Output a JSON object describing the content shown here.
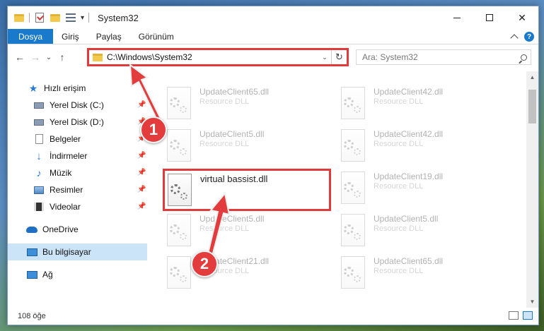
{
  "window": {
    "title": "System32",
    "controls": {
      "minimize": "",
      "maximize": "",
      "close": "✕"
    }
  },
  "ribbon": {
    "tabs": [
      "Dosya",
      "Giriş",
      "Paylaş",
      "Görünüm"
    ],
    "help": "?"
  },
  "nav": {
    "back": "←",
    "forward": "→",
    "recent": "⌄",
    "up": "↑",
    "address": "C:\\Windows\\System32",
    "address_chevron": "⌄",
    "refresh": "↻",
    "search_placeholder": "Ara: System32"
  },
  "sidebar": {
    "quick_access": "Hızlı erişim",
    "items": [
      {
        "label": "Yerel Disk (C:)",
        "icon": "drive-icon"
      },
      {
        "label": "Yerel Disk (D:)",
        "icon": "drive-icon"
      },
      {
        "label": "Belgeler",
        "icon": "documents-icon"
      },
      {
        "label": "İndirmeler",
        "icon": "downloads-icon"
      },
      {
        "label": "Müzik",
        "icon": "music-icon"
      },
      {
        "label": "Resimler",
        "icon": "pictures-icon"
      },
      {
        "label": "Videolar",
        "icon": "videos-icon"
      }
    ],
    "onedrive": "OneDrive",
    "this_pc": "Bu bilgisayar",
    "network": "Ağ"
  },
  "files": {
    "left_column": [
      {
        "name": "UpdateClient65.dll",
        "desc": "Resource DLL"
      },
      {
        "name": "UpdateClient5.dll",
        "desc": "Resource DLL"
      },
      {
        "name": "UpdateClient5.dll",
        "desc": "Resource DLL"
      },
      {
        "name": "UpdateClient21.dll",
        "desc": "Resource DLL"
      }
    ],
    "right_column": [
      {
        "name": "UpdateClient42.dll",
        "desc": "Resource DLL"
      },
      {
        "name": "UpdateClient42.dll",
        "desc": "Resource DLL"
      },
      {
        "name": "UpdateClient19.dll",
        "desc": "Resource DLL"
      },
      {
        "name": "UpdateClient5.dll",
        "desc": "Resource DLL"
      },
      {
        "name": "UpdateClient65.dll",
        "desc": "Resource DLL"
      }
    ],
    "highlighted": {
      "name": "virtual bassist.dll"
    }
  },
  "status": {
    "count": "108 öğe"
  },
  "annotations": {
    "step1": "1",
    "step2": "2"
  },
  "colors": {
    "accent": "#1979ca",
    "highlight": "#e03a3a"
  }
}
